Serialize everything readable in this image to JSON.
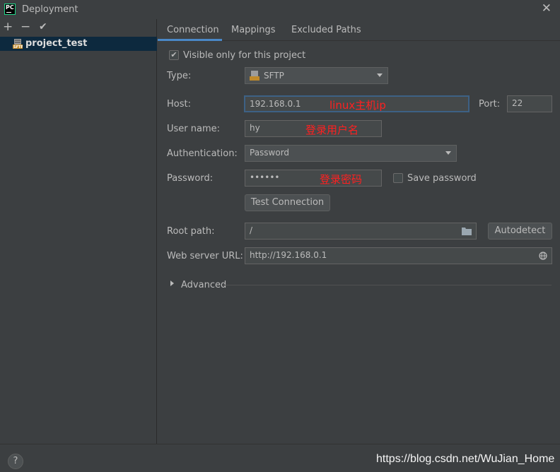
{
  "window": {
    "title": "Deployment",
    "app_logo": "PC"
  },
  "left_toolbar": {
    "add": "+",
    "remove": "−",
    "apply": "✔"
  },
  "servers": [
    {
      "name": "project_test",
      "icon": "sftp-server-icon"
    }
  ],
  "tabs": [
    {
      "label": "Connection",
      "active": true
    },
    {
      "label": "Mappings",
      "active": false
    },
    {
      "label": "Excluded Paths",
      "active": false
    }
  ],
  "connection": {
    "visible_only_label": "Visible only for this project",
    "visible_only_checked": true,
    "type_label": "Type:",
    "type_value": "SFTP",
    "host_label": "Host:",
    "host_value": "192.168.0.1",
    "port_label": "Port:",
    "port_value": "22",
    "user_label": "User name:",
    "user_value": "hy",
    "auth_label": "Authentication:",
    "auth_value": "Password",
    "password_label": "Password:",
    "password_value": "••••••",
    "save_password_label": "Save password",
    "save_password_checked": false,
    "test_button": "Test Connection",
    "root_label": "Root path:",
    "root_value": "/",
    "autodetect_button": "Autodetect",
    "web_url_label": "Web server URL:",
    "web_url_value": "http://192.168.0.1",
    "advanced_label": "Advanced"
  },
  "annotations": {
    "host": "linux主机ip",
    "user": "登录用户名",
    "password": "登录密码"
  },
  "bottom": {
    "help": "?",
    "watermark": "https://blog.csdn.net/WuJian_Home"
  }
}
